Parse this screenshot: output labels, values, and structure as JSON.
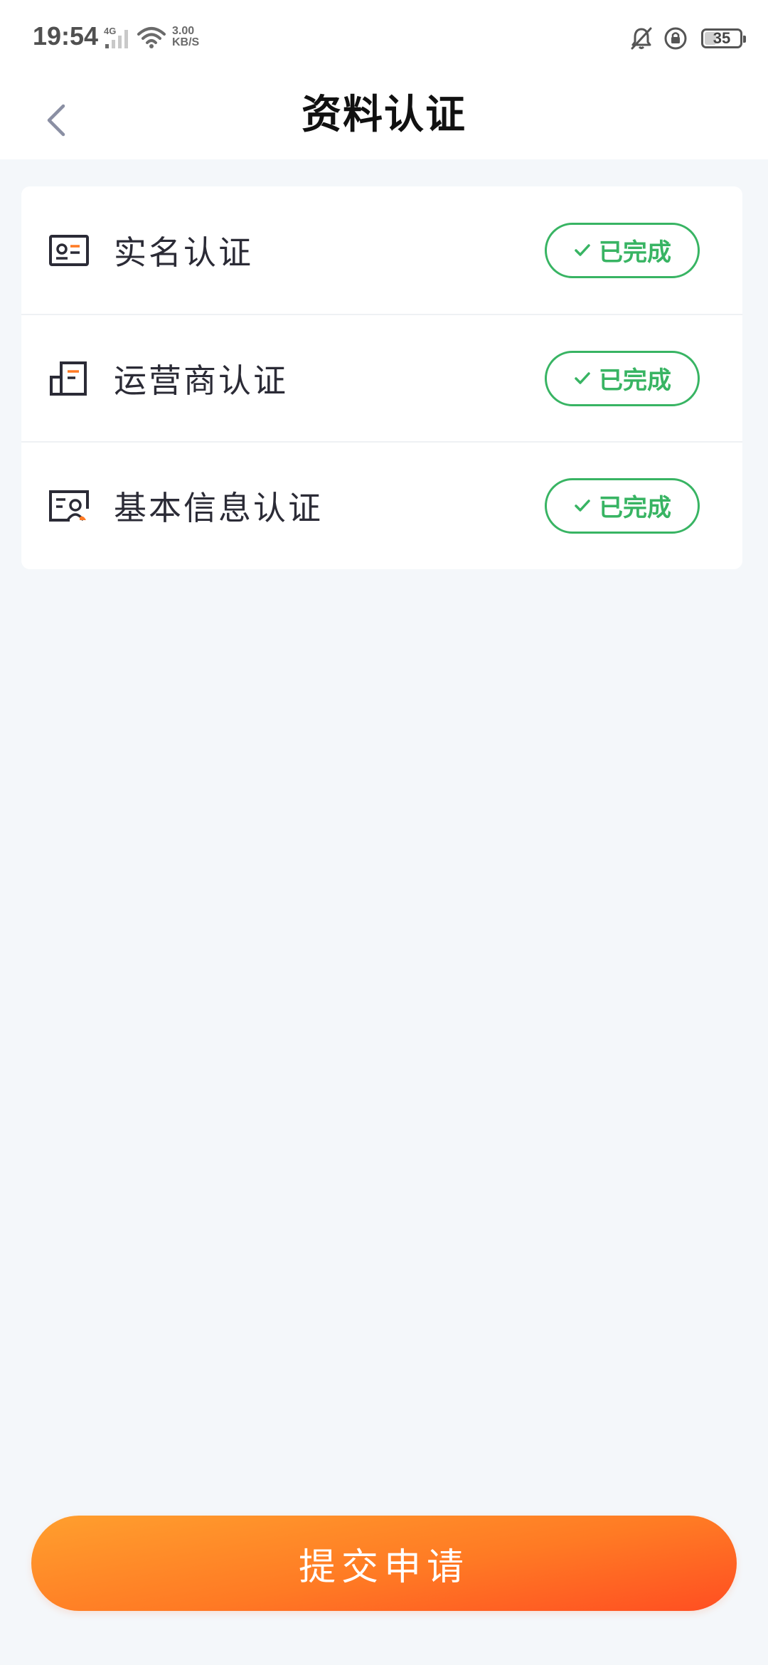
{
  "status_bar": {
    "time": "19:54",
    "network_label": "4G",
    "speed_value": "3.00",
    "speed_unit": "KB/S",
    "battery": "35"
  },
  "header": {
    "title": "资料认证",
    "back_icon": "chevron-left-icon"
  },
  "verification_items": [
    {
      "label": "实名认证",
      "status": "已完成",
      "icon": "id-card-icon"
    },
    {
      "label": "运营商认证",
      "status": "已完成",
      "icon": "carrier-building-icon"
    },
    {
      "label": "基本信息认证",
      "status": "已完成",
      "icon": "profile-info-icon"
    }
  ],
  "submit": {
    "label": "提交申请"
  },
  "colors": {
    "accent_green": "#38b463",
    "accent_orange": "#ff7a24",
    "background": "#f4f7fa"
  }
}
